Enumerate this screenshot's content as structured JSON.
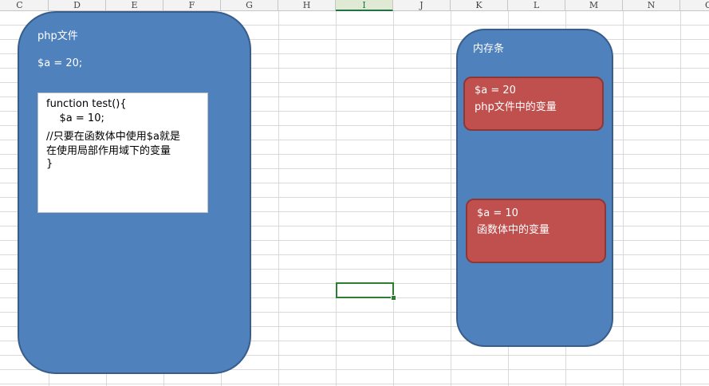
{
  "columns": [
    "C",
    "D",
    "E",
    "F",
    "G",
    "H",
    "I",
    "J",
    "K",
    "L",
    "M",
    "N",
    "O"
  ],
  "active_column": "I",
  "php_file": {
    "title": "php文件",
    "global_var": "$a = 20;",
    "code_lines": [
      "function test(){",
      "    $a = 10;",
      "//只要在函数体中使用$a就是",
      "在使用局部作用域下的变量",
      "}"
    ]
  },
  "memory": {
    "title": "内存条",
    "box1": {
      "line1": "$a = 20",
      "line2": "php文件中的变量"
    },
    "box2": {
      "line1": "$a = 10",
      "line2": "函数体中的变量"
    }
  },
  "colors": {
    "shape_blue": "#4f81bd",
    "shape_red": "#c0504d",
    "selection": "#2e7d32"
  }
}
